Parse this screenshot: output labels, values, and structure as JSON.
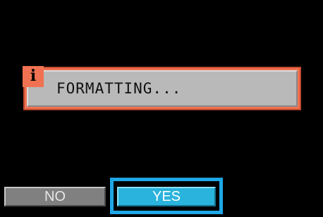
{
  "dialog": {
    "icon": "info-icon",
    "icon_glyph": "i",
    "message": "FORMATTING..."
  },
  "buttons": {
    "no_label": "NO",
    "yes_label": "YES",
    "selected": "YES"
  },
  "colors": {
    "background": "#000000",
    "dialog_frame": "#f07252",
    "dialog_body": "#b9b9b9",
    "yes_button": "#2ab3dc",
    "no_button": "#808080",
    "selection": "#1ea7e6"
  }
}
